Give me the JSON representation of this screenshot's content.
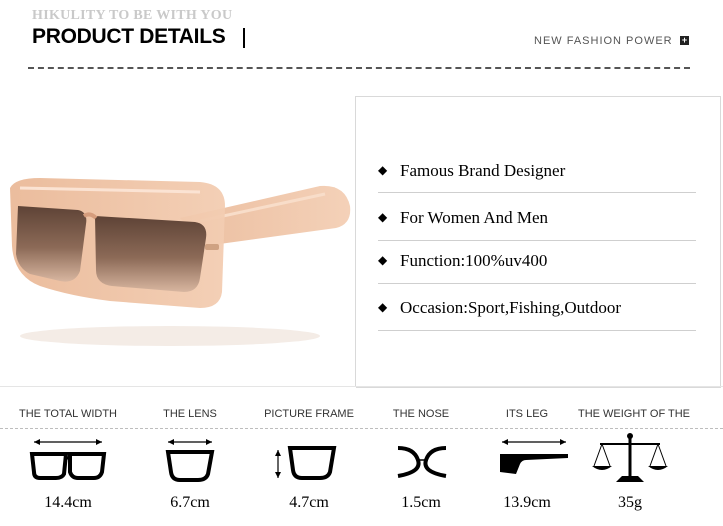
{
  "header": {
    "subtitle": "HIKULITY TO BE WITH YOU",
    "title": "PRODUCT DETAILS",
    "right_text": "NEW FASHION POWER",
    "plus_glyph": "+"
  },
  "features": [
    {
      "icon": "diamond-bullet-icon",
      "text": "Famous Brand Designer"
    },
    {
      "icon": "diamond-bullet-icon",
      "text": "For Women And Men"
    },
    {
      "icon": "diamond-bullet-icon",
      "text": "Function:100%uv400"
    },
    {
      "icon": "diamond-bullet-icon",
      "text": "Occasion:Sport,Fishing,Outdoor"
    }
  ],
  "bullet_glyph": "◆",
  "specs": [
    {
      "label": "THE TOTAL WIDTH",
      "value": "14.4cm",
      "icon": "total-width-icon"
    },
    {
      "label": "THE LENS",
      "value": "6.7cm",
      "icon": "lens-width-icon"
    },
    {
      "label": "PICTURE FRAME",
      "value": "4.7cm",
      "icon": "frame-height-icon"
    },
    {
      "label": "THE NOSE",
      "value": "1.5cm",
      "icon": "nose-bridge-icon"
    },
    {
      "label": "ITS LEG",
      "value": "13.9cm",
      "icon": "temple-length-icon"
    },
    {
      "label": "THE WEIGHT OF THE",
      "value": "35g",
      "icon": "weight-scale-icon"
    }
  ],
  "colors": {
    "frame": "#e9b99a",
    "lens": "#7a5a4a",
    "accent": "#000000"
  }
}
